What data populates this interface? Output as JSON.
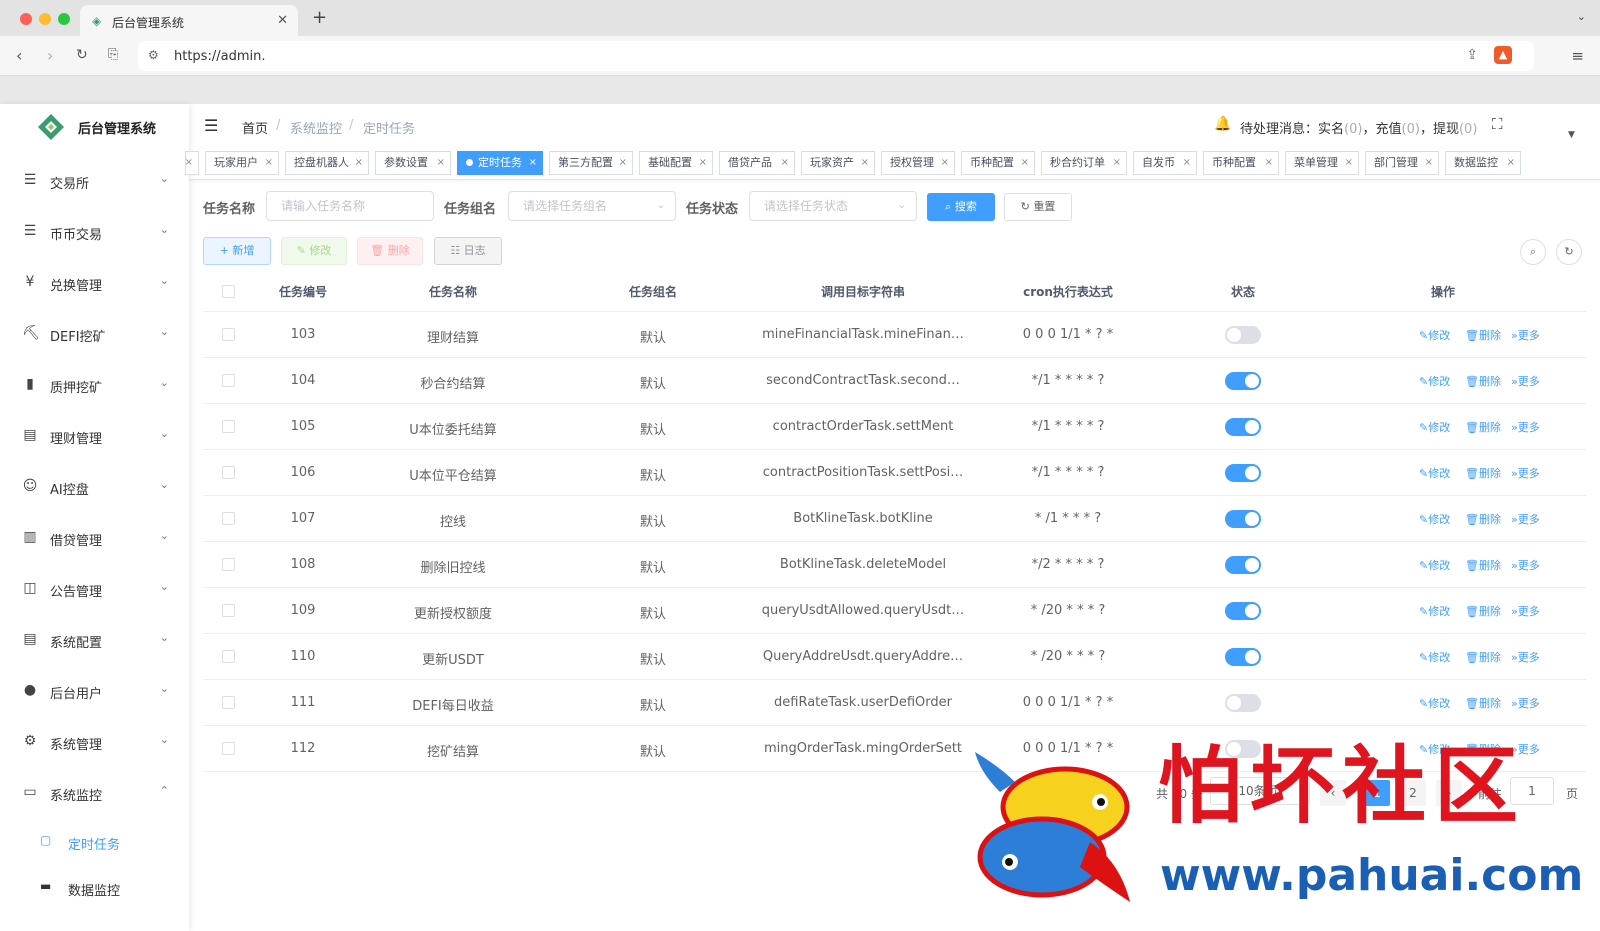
{
  "browser": {
    "tab_title": "后台管理系统",
    "url": "https://admin."
  },
  "sidebar": {
    "app_title": "后台管理系统",
    "items": [
      {
        "label": "交易所",
        "icon": "list-icon"
      },
      {
        "label": "币币交易",
        "icon": "list-icon"
      },
      {
        "label": "兑换管理",
        "icon": "yen-icon"
      },
      {
        "label": "DEFI挖矿",
        "icon": "pickaxe-icon"
      },
      {
        "label": "质押挖矿",
        "icon": "bar-chart-icon"
      },
      {
        "label": "理财管理",
        "icon": "document-icon"
      },
      {
        "label": "AI控盘",
        "icon": "robot-icon"
      },
      {
        "label": "借贷管理",
        "icon": "book-icon"
      },
      {
        "label": "公告管理",
        "icon": "open-book-icon"
      },
      {
        "label": "系统配置",
        "icon": "document-icon"
      },
      {
        "label": "后台用户",
        "icon": "user-icon"
      },
      {
        "label": "系统管理",
        "icon": "gear-icon"
      },
      {
        "label": "系统监控",
        "icon": "monitor-icon"
      }
    ],
    "sub_items": [
      {
        "label": "定时任务",
        "icon": "job-icon",
        "active": true
      },
      {
        "label": "数据监控",
        "icon": "screen-icon",
        "active": false
      }
    ]
  },
  "header": {
    "breadcrumb": [
      "首页",
      "系统监控",
      "定时任务"
    ],
    "notice_prefix": "待处理消息：",
    "notices": [
      {
        "label": "实名",
        "count": "0"
      },
      {
        "label": "充值",
        "count": "0"
      },
      {
        "label": "提现",
        "count": "0"
      }
    ]
  },
  "tags": [
    {
      "label": "",
      "active": false
    },
    {
      "label": "玩家用户",
      "active": false
    },
    {
      "label": "控盘机器人",
      "active": false
    },
    {
      "label": "参数设置",
      "active": false
    },
    {
      "label": "定时任务",
      "active": true
    },
    {
      "label": "第三方配置",
      "active": false
    },
    {
      "label": "基础配置",
      "active": false
    },
    {
      "label": "借贷产品",
      "active": false
    },
    {
      "label": "玩家资产",
      "active": false
    },
    {
      "label": "授权管理",
      "active": false
    },
    {
      "label": "币种配置",
      "active": false
    },
    {
      "label": "秒合约订单",
      "active": false
    },
    {
      "label": "自发币",
      "active": false
    },
    {
      "label": "币种配置",
      "active": false
    },
    {
      "label": "菜单管理",
      "active": false
    },
    {
      "label": "部门管理",
      "active": false
    },
    {
      "label": "数据监控",
      "active": false
    }
  ],
  "search": {
    "task_name_label": "任务名称",
    "task_name_placeholder": "请输入任务名称",
    "task_group_label": "任务组名",
    "task_group_placeholder": "请选择任务组名",
    "task_status_label": "任务状态",
    "task_status_placeholder": "请选择任务状态",
    "search_button": "搜索",
    "reset_button": "重置"
  },
  "toolbar": {
    "add": "新增",
    "edit": "修改",
    "delete": "删除",
    "log": "日志"
  },
  "table": {
    "columns": [
      "任务编号",
      "任务名称",
      "任务组名",
      "调用目标字符串",
      "cron执行表达式",
      "状态",
      "操作"
    ],
    "rows": [
      {
        "id": "103",
        "name": "理财结算",
        "group": "默认",
        "target": "mineFinancialTask.mineFinan…",
        "cron": "0 0 0 1/1 * ? *",
        "enabled": false
      },
      {
        "id": "104",
        "name": "秒合约结算",
        "group": "默认",
        "target": "secondContractTask.second…",
        "cron": "*/1 * * * * ?",
        "enabled": true
      },
      {
        "id": "105",
        "name": "U本位委托结算",
        "group": "默认",
        "target": "contractOrderTask.settMent",
        "cron": "*/1 * * * * ?",
        "enabled": true
      },
      {
        "id": "106",
        "name": "U本位平仓结算",
        "group": "默认",
        "target": "contractPositionTask.settPosi…",
        "cron": "*/1 * * * * ?",
        "enabled": true
      },
      {
        "id": "107",
        "name": "控线",
        "group": "默认",
        "target": "BotKlineTask.botKline",
        "cron": "* /1 * * * ?",
        "enabled": true
      },
      {
        "id": "108",
        "name": "删除旧控线",
        "group": "默认",
        "target": "BotKlineTask.deleteModel",
        "cron": "*/2 * * * * ?",
        "enabled": true
      },
      {
        "id": "109",
        "name": "更新授权额度",
        "group": "默认",
        "target": "queryUsdtAllowed.queryUsdt…",
        "cron": "* /20 * * * ?",
        "enabled": true
      },
      {
        "id": "110",
        "name": "更新USDT",
        "group": "默认",
        "target": "QueryAddreUsdt.queryAddre…",
        "cron": "* /20 * * * ?",
        "enabled": true
      },
      {
        "id": "111",
        "name": "DEFI每日收益",
        "group": "默认",
        "target": "defiRateTask.userDefiOrder",
        "cron": "0 0 0 1/1 * ? *",
        "enabled": false
      },
      {
        "id": "112",
        "name": "挖矿结算",
        "group": "默认",
        "target": "mingOrderTask.mingOrderSett",
        "cron": "0 0 0 1/1 * ? *",
        "enabled": false
      }
    ],
    "actions": {
      "edit": "修改",
      "delete": "删除",
      "more": "更多"
    }
  },
  "pagination": {
    "total_prefix": "共",
    "total_suffix": "条",
    "page_size": "10条/页",
    "pages": [
      "1",
      "2"
    ],
    "goto_prefix": "前往",
    "goto_value": "1",
    "goto_suffix": "页"
  },
  "watermark": {
    "text": "怕坏社区",
    "url": "www.pahuai.com"
  }
}
